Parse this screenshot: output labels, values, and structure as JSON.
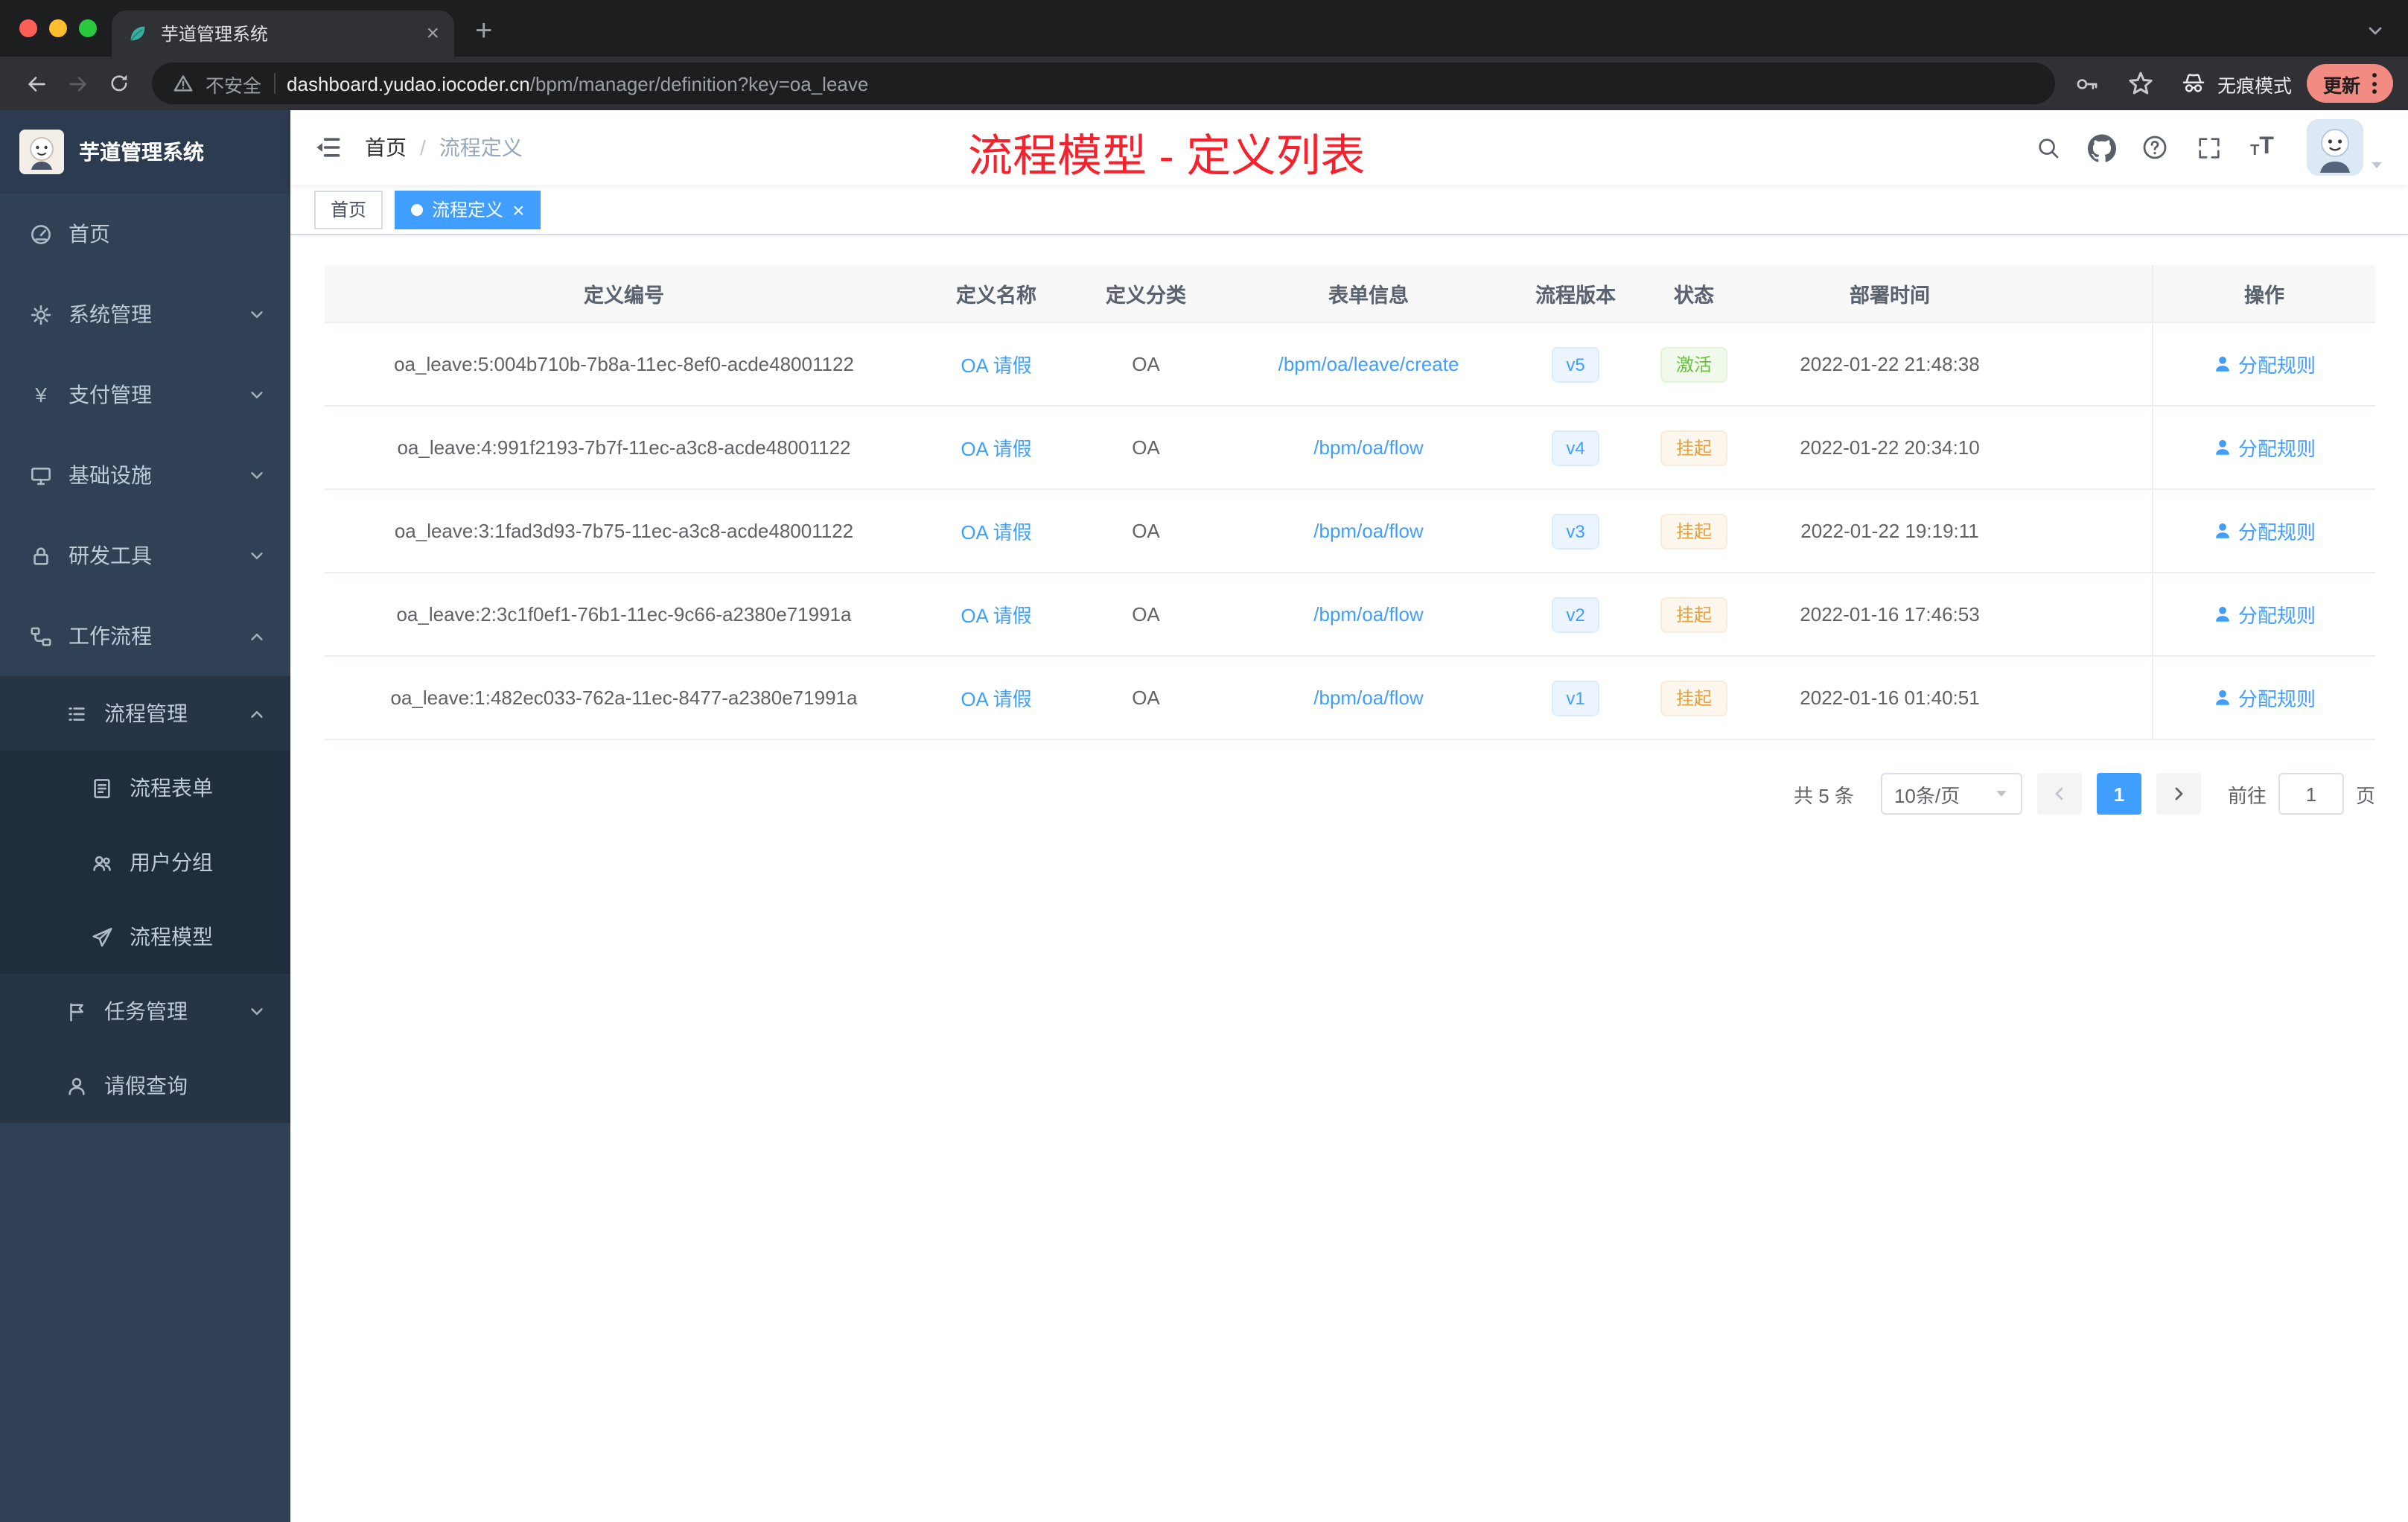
{
  "colors": {
    "accent": "#409eff",
    "annotation": "#f5222d",
    "success": "#67c23a",
    "warning": "#e6a23c"
  },
  "browser": {
    "tab_title": "芋道管理系统",
    "security_label": "不安全",
    "url_domain": "dashboard.yudao.iocoder.cn",
    "url_path": "/bpm/manager/definition?key=oa_leave",
    "incognito_label": "无痕模式",
    "update_label": "更新"
  },
  "sidebar": {
    "logo_title": "芋道管理系统",
    "menu": [
      {
        "label": "首页"
      },
      {
        "label": "系统管理"
      },
      {
        "label": "支付管理"
      },
      {
        "label": "基础设施"
      },
      {
        "label": "研发工具"
      },
      {
        "label": "工作流程"
      },
      {
        "label": "流程管理"
      },
      {
        "label": "流程表单"
      },
      {
        "label": "用户分组"
      },
      {
        "label": "流程模型"
      },
      {
        "label": "任务管理"
      },
      {
        "label": "请假查询"
      }
    ]
  },
  "header": {
    "breadcrumb_home": "首页",
    "breadcrumb_separator": "/",
    "breadcrumb_current": "流程定义",
    "annotation": "流程模型 - 定义列表"
  },
  "tags": {
    "home": "首页",
    "active": "流程定义"
  },
  "table": {
    "columns": [
      "定义编号",
      "定义名称",
      "定义分类",
      "表单信息",
      "流程版本",
      "状态",
      "部署时间",
      "操作"
    ],
    "rows": [
      {
        "id": "oa_leave:5:004b710b-7b8a-11ec-8ef0-acde48001122",
        "name": "OA 请假",
        "category": "OA",
        "form": "/bpm/oa/leave/create",
        "version": "v5",
        "status": "激活",
        "time": "2022-01-22 21:48:38",
        "action": "分配规则"
      },
      {
        "id": "oa_leave:4:991f2193-7b7f-11ec-a3c8-acde48001122",
        "name": "OA 请假",
        "category": "OA",
        "form": "/bpm/oa/flow",
        "version": "v4",
        "status": "挂起",
        "time": "2022-01-22 20:34:10",
        "action": "分配规则"
      },
      {
        "id": "oa_leave:3:1fad3d93-7b75-11ec-a3c8-acde48001122",
        "name": "OA 请假",
        "category": "OA",
        "form": "/bpm/oa/flow",
        "version": "v3",
        "status": "挂起",
        "time": "2022-01-22 19:19:11",
        "action": "分配规则"
      },
      {
        "id": "oa_leave:2:3c1f0ef1-76b1-11ec-9c66-a2380e71991a",
        "name": "OA 请假",
        "category": "OA",
        "form": "/bpm/oa/flow",
        "version": "v2",
        "status": "挂起",
        "time": "2022-01-16 17:46:53",
        "action": "分配规则"
      },
      {
        "id": "oa_leave:1:482ec033-762a-11ec-8477-a2380e71991a",
        "name": "OA 请假",
        "category": "OA",
        "form": "/bpm/oa/flow",
        "version": "v1",
        "status": "挂起",
        "time": "2022-01-16 01:40:51",
        "action": "分配规则"
      }
    ]
  },
  "pagination": {
    "total": "共 5 条",
    "page_size": "10条/页",
    "current_page": "1",
    "goto_label": "前往",
    "goto_value": "1",
    "page_unit": "页"
  }
}
